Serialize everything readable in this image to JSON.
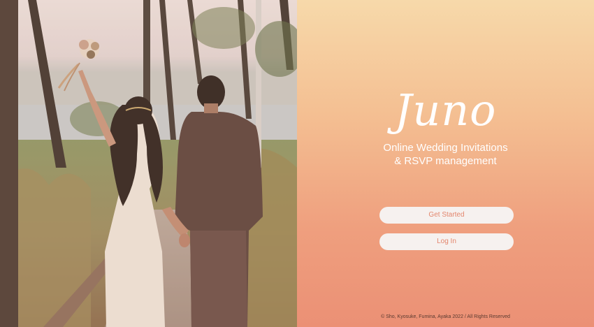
{
  "brand": {
    "name": "Juno",
    "tagline_line1": "Online Wedding Invitations",
    "tagline_line2": "& RSVP management"
  },
  "actions": {
    "get_started": "Get Started",
    "log_in": "Log In"
  },
  "footer": {
    "copyright": "© Sho, Kyosuke, Fumina, Ayaka 2022 / All Rights Reserved"
  },
  "colors": {
    "gradient_top": "#f7d9aa",
    "gradient_bottom": "#eb9075",
    "button_bg": "#f6f1ef",
    "button_text": "#e3866d"
  },
  "hero_image": {
    "icon": "wedding-couple-photo"
  }
}
